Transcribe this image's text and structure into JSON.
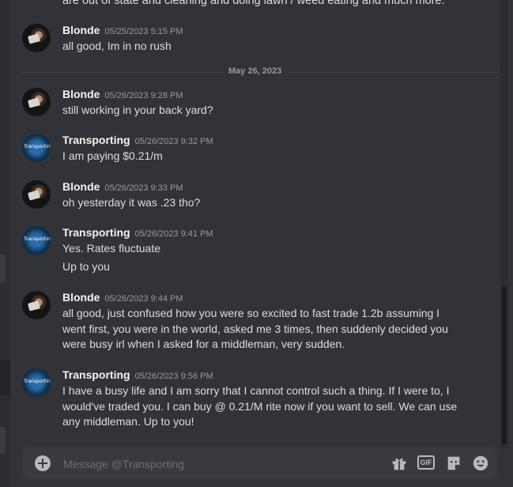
{
  "partial_top_text": "are out of state and cleaning and doing lawn / weed eating and much more.",
  "date_divider": "May 26, 2023",
  "messages": [
    {
      "author": "Blonde",
      "timestamp": "05/25/2023 5:15 PM",
      "lines": [
        "all good, Im in no rush"
      ]
    },
    {
      "author": "Blonde",
      "timestamp": "05/26/2023 9:28 PM",
      "lines": [
        "still working in your back yard?"
      ]
    },
    {
      "author": "Transporting",
      "timestamp": "05/26/2023 9:32 PM",
      "lines": [
        "I am paying $0.21/m"
      ]
    },
    {
      "author": "Blonde",
      "timestamp": "05/26/2023 9:33 PM",
      "lines": [
        "oh yesterday it was .23 tho?"
      ]
    },
    {
      "author": "Transporting",
      "timestamp": "05/26/2023 9:41 PM",
      "lines": [
        "Yes. Rates fluctuate",
        "Up to you"
      ]
    },
    {
      "author": "Blonde",
      "timestamp": "05/26/2023 9:44 PM",
      "lines": [
        "all good, just confused how you were so excited to fast trade 1.2b assuming I went first, you were in the world, asked me 3 times, then suddenly decided you were busy irl when I asked for a middleman, very sudden."
      ]
    },
    {
      "author": "Transporting",
      "timestamp": "05/26/2023 9:56 PM",
      "lines": [
        "I have a busy life and I am sorry that I cannot control such a thing. If I were to, I would've traded you. I can buy @ 0.21/M rite now if you want to sell. We can use any middleman. Up to you!"
      ]
    }
  ],
  "avatar_text": "Transporting",
  "composer": {
    "placeholder": "Message @Transporting",
    "gif_label": "GIF"
  },
  "icons": {
    "add": "plus-circle-icon",
    "gift": "gift-icon",
    "gif": "gif-icon",
    "sticker": "sticker-icon",
    "emoji": "emoji-icon"
  }
}
